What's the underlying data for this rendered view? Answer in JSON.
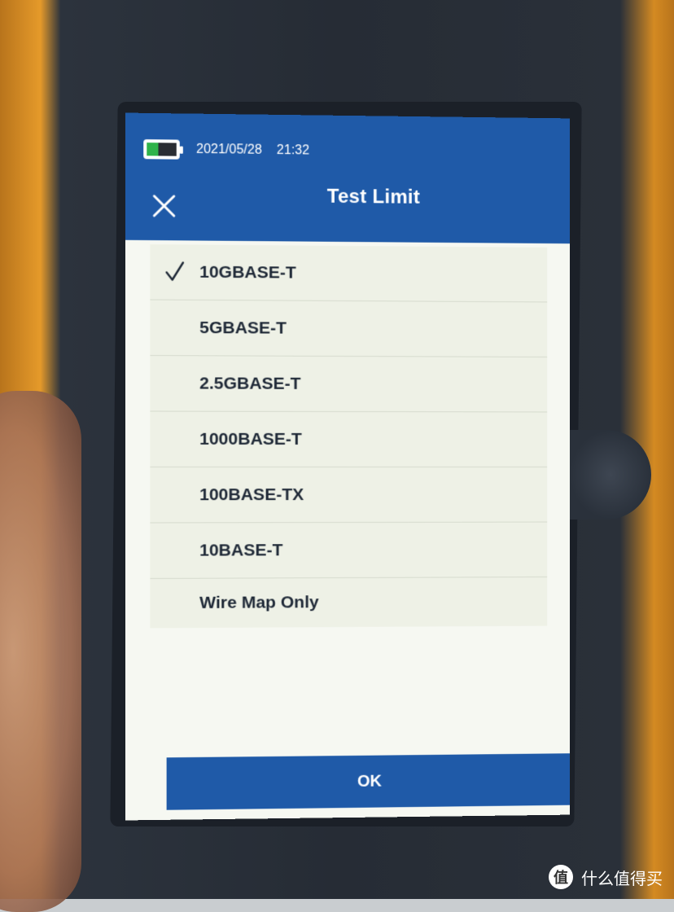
{
  "status": {
    "date": "2021/05/28",
    "time": "21:32",
    "battery_level": 0.4
  },
  "header": {
    "title": "Test Limit",
    "close_icon": "close-icon"
  },
  "limits": {
    "selected": "10GBASE-T",
    "items": [
      {
        "label": "10GBASE-T",
        "checked": true
      },
      {
        "label": "5GBASE-T",
        "checked": false
      },
      {
        "label": "2.5GBASE-T",
        "checked": false
      },
      {
        "label": "1000BASE-T",
        "checked": false
      },
      {
        "label": "100BASE-TX",
        "checked": false
      },
      {
        "label": "10BASE-T",
        "checked": false
      },
      {
        "label": "Wire Map Only",
        "checked": false
      }
    ]
  },
  "footer": {
    "ok_label": "OK"
  },
  "watermark": {
    "logo_glyph": "值",
    "text": "什么值得买"
  },
  "colors": {
    "header_blue": "#1f5aa8",
    "battery_green": "#2fb34a",
    "list_background": "#eef1e6"
  }
}
